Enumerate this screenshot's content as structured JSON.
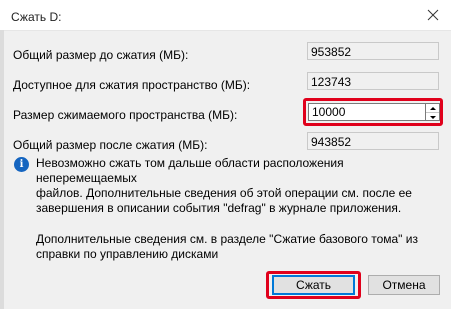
{
  "window": {
    "title": "Сжать D:",
    "close_icon": "close-icon"
  },
  "fields": {
    "total_before": {
      "label": "Общий размер до сжатия (МБ):",
      "value": "953852"
    },
    "available": {
      "label": "Доступное для сжатия пространство (МБ):",
      "value": "123743"
    },
    "shrink_amount": {
      "label": "Размер сжимаемого пространства (МБ):",
      "value": "10000"
    },
    "total_after": {
      "label": "Общий размер после сжатия (МБ):",
      "value": "943852"
    }
  },
  "info": {
    "icon": "info-icon",
    "line1": "Невозможно сжать том дальше области расположения неперемещаемых",
    "line2": "файлов. Дополнительные сведения об этой операции см. после ее",
    "line3": "завершения в описании события \"defrag\" в журнале приложения."
  },
  "more_info": {
    "line1": "Дополнительные сведения см. в разделе \"Сжатие базового тома\" из",
    "line2": "справки по управлению дисками"
  },
  "buttons": {
    "shrink": "Сжать",
    "cancel": "Отмена"
  },
  "colors": {
    "highlight": "#e0001b",
    "info_blue": "#1565c0",
    "focus_blue": "#0078d7"
  }
}
